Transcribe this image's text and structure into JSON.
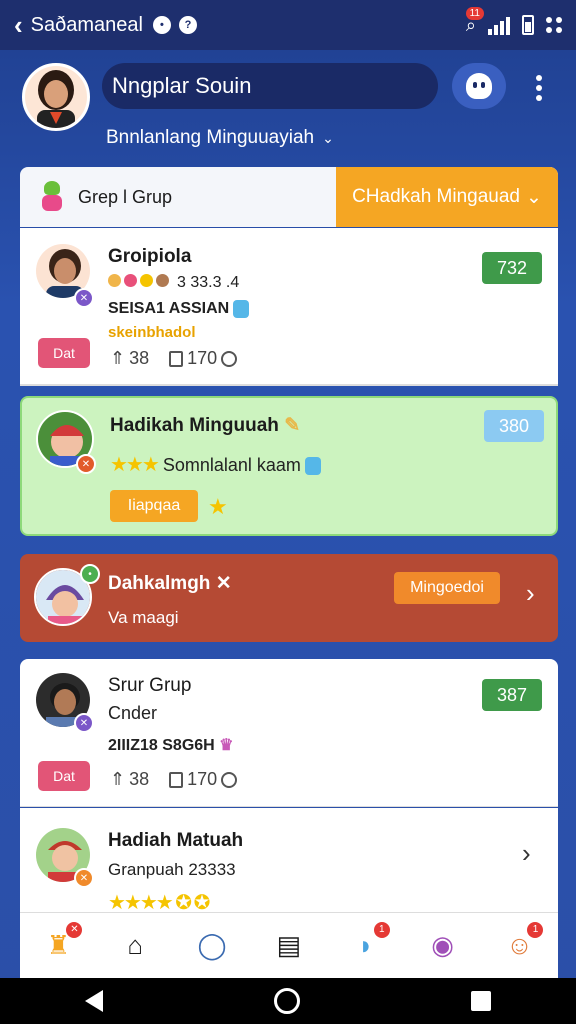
{
  "status": {
    "title": "Saðamaneal",
    "notif_count": "11"
  },
  "profile": {
    "name": "Nngplar Souin",
    "subtitle": "Bnnlanlang Minguuayiah"
  },
  "tabs": {
    "left_label": "Grep l Grup",
    "right_label": "CHadkah Mingauad"
  },
  "rows": [
    {
      "title": "Groipiola",
      "line1": "3 33.3 .4",
      "line2": "SEISA1 ASSIAN",
      "line3": "skeinbhadol",
      "tag": "Dat",
      "stat1": "38",
      "stat2": "170",
      "score": "732",
      "score_color": "#3f9a4a"
    },
    {
      "title": "Hadikah Minguuah",
      "line1": "Somnlalanl kaam",
      "button": "Iiapqaa",
      "score": "380",
      "score_color": "#8ccaf2"
    },
    {
      "title": "Dahkalmgh",
      "line1": "Va maagi",
      "button": "Mingoedoi"
    },
    {
      "title": "Srur Grup",
      "line1": "Cnder",
      "line2": "2IIIZ18 S8G6H",
      "tag": "Dat",
      "stat1": "38",
      "stat2": "170",
      "score": "387",
      "score_color": "#3f9a4a"
    },
    {
      "title": "Hadiah Matuah",
      "line1": "Granpuah 23333"
    }
  ],
  "nav": [
    {
      "icon": "trophy-icon",
      "badge": ""
    },
    {
      "icon": "home-icon",
      "badge": ""
    },
    {
      "icon": "search-icon",
      "badge": ""
    },
    {
      "icon": "document-icon",
      "badge": ""
    },
    {
      "icon": "chat-icon",
      "badge": "1"
    },
    {
      "icon": "message-icon",
      "badge": ""
    },
    {
      "icon": "profile-icon",
      "badge": "1"
    }
  ]
}
